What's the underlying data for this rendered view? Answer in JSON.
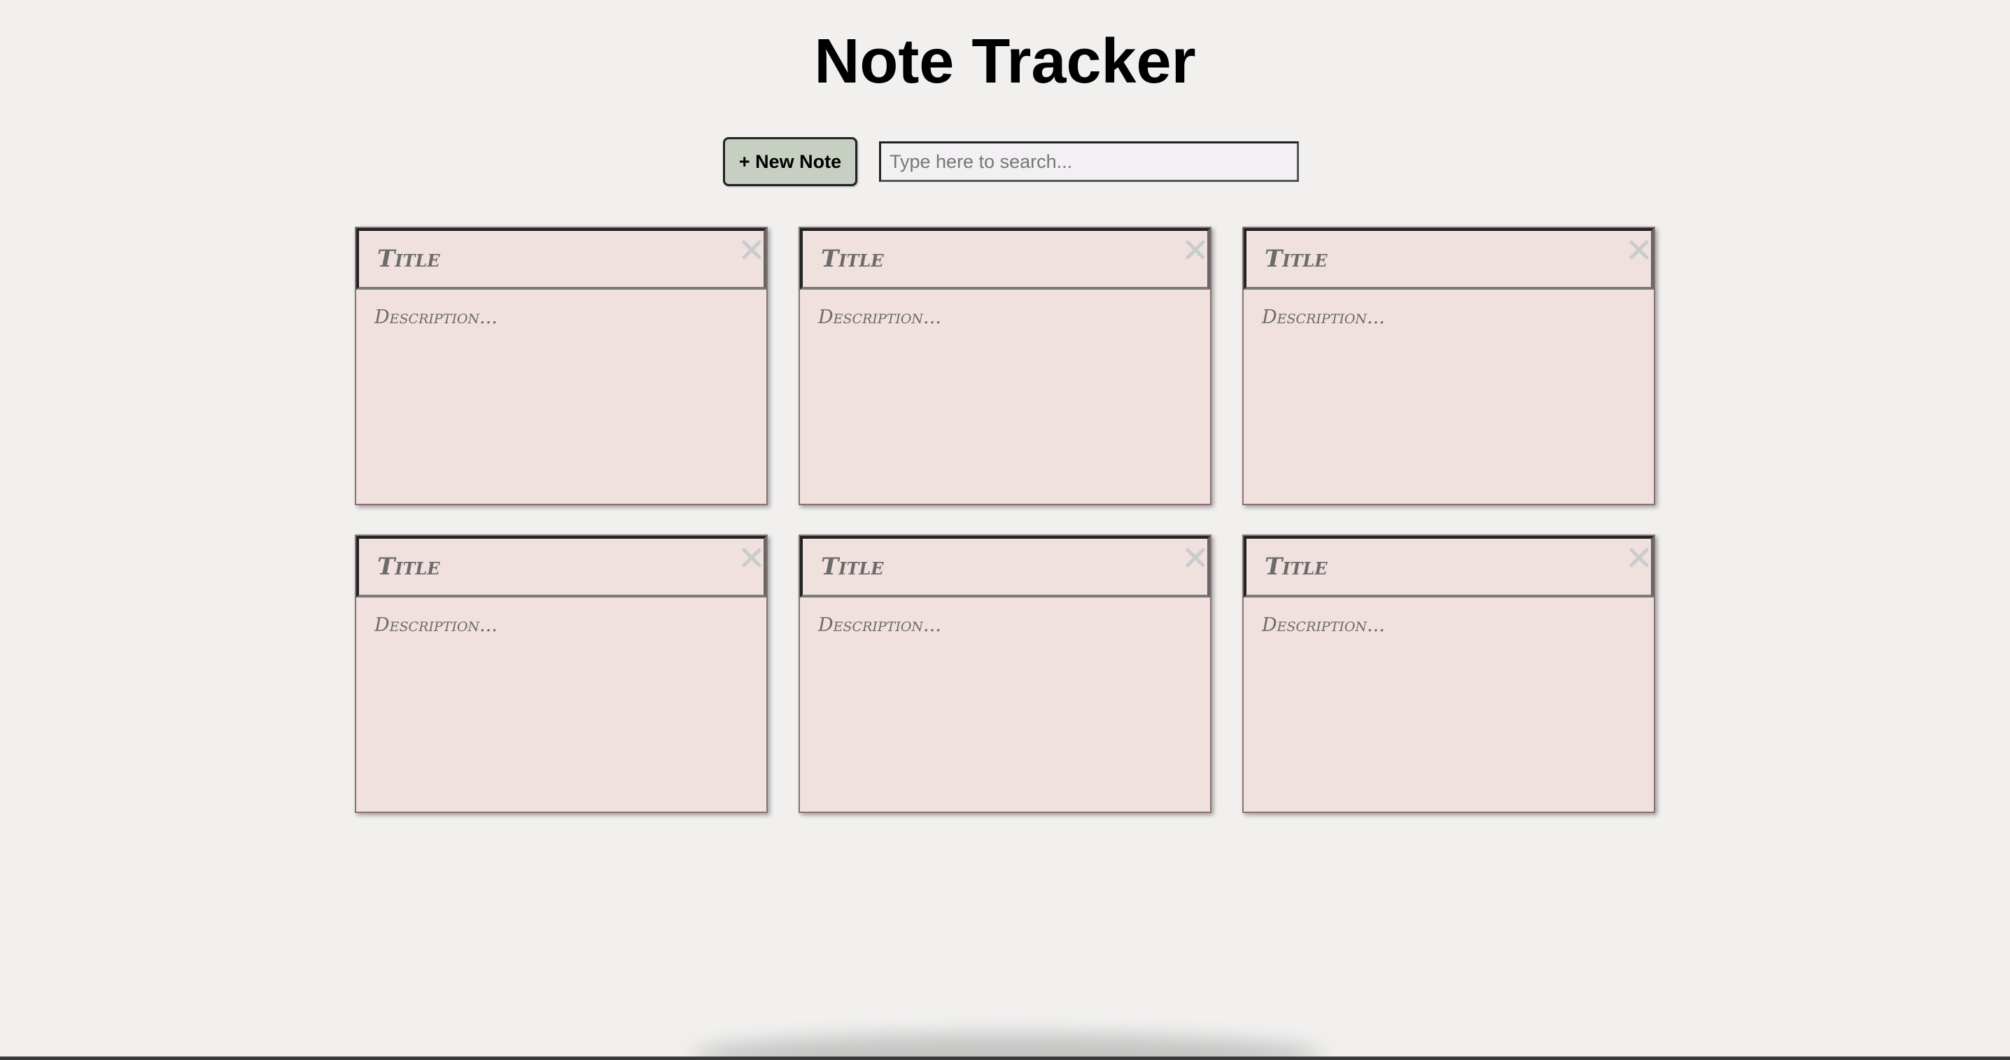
{
  "header": {
    "title": "Note Tracker"
  },
  "toolbar": {
    "new_note_label": "+ New Note",
    "search_placeholder": "Type here to search...",
    "search_value": ""
  },
  "notes": [
    {
      "title": "Title",
      "description": "Description..."
    },
    {
      "title": "Title",
      "description": "Description..."
    },
    {
      "title": "Title",
      "description": "Description..."
    },
    {
      "title": "Title",
      "description": "Description..."
    },
    {
      "title": "Title",
      "description": "Description..."
    },
    {
      "title": "Title",
      "description": "Description..."
    }
  ],
  "icons": {
    "close": "close-icon"
  },
  "colors": {
    "background": "#f1f0ef",
    "note_background": "#f0e0de",
    "new_note_button": "#c6cfc1",
    "close_icon": "#c9cccc"
  }
}
